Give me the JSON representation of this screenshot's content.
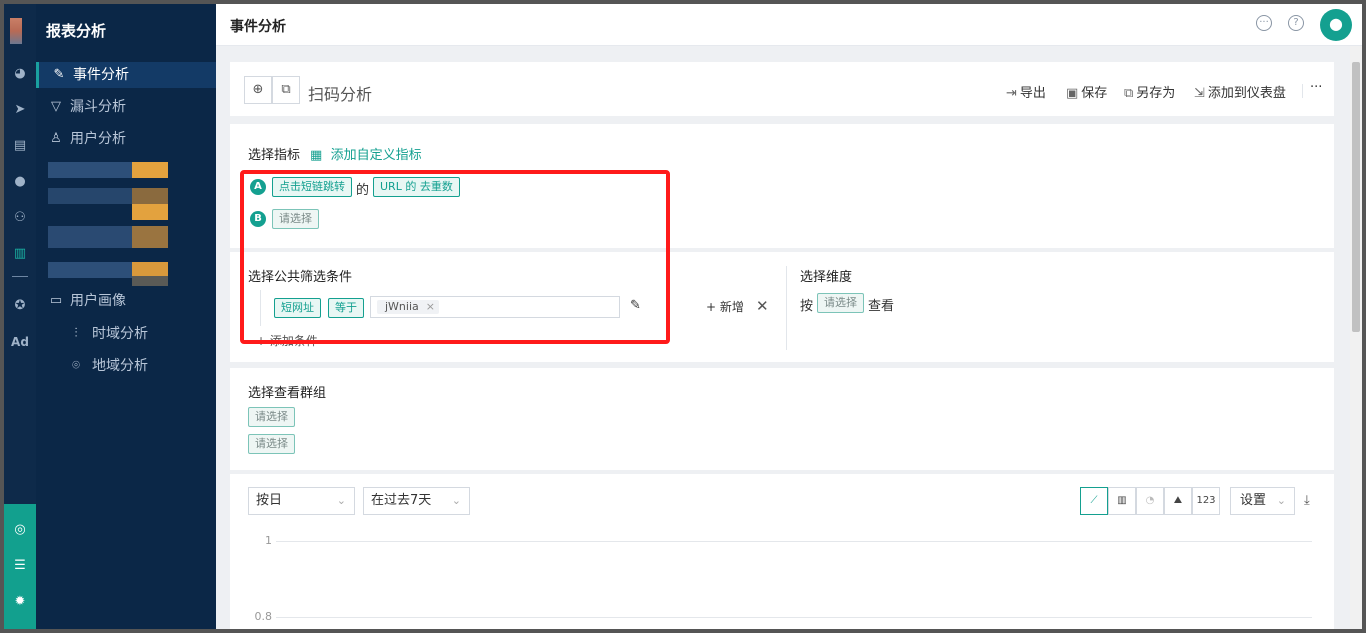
{
  "app": {
    "title": "报表分析"
  },
  "sidebar": {
    "items": [
      {
        "label": "事件分析",
        "icon": "edit-doc-icon"
      },
      {
        "label": "漏斗分析",
        "icon": "funnel-icon"
      },
      {
        "label": "用户分析",
        "icon": "user-icon"
      },
      {
        "label": "用户画像",
        "icon": "folder-icon"
      }
    ],
    "sub_items": [
      {
        "label": "时域分析",
        "icon": "bar-chart-icon"
      },
      {
        "label": "地域分析",
        "icon": "location-icon"
      }
    ]
  },
  "rail": {
    "ad_label": "Ad"
  },
  "topbar": {
    "title": "事件分析"
  },
  "header": {
    "analysis_name": "扫码分析",
    "export_label": "导出",
    "save_label": "保存",
    "save_as_label": "另存为",
    "add_dashboard_label": "添加到仪表盘",
    "more_label": "···"
  },
  "metrics": {
    "title": "选择指标",
    "add_custom_label": "添加自定义指标",
    "row_a": {
      "badge": "A",
      "event": "点击短链跳转",
      "connector": "的",
      "measure": "URL 的 去重数"
    },
    "row_b": {
      "badge": "B",
      "placeholder": "请选择"
    }
  },
  "filters": {
    "title": "选择公共筛选条件",
    "field": "短网址",
    "operator": "等于",
    "value_chip": "jWniia",
    "new_label": "新增",
    "add_condition_label": "添加条件"
  },
  "dimension": {
    "title": "选择维度",
    "prefix": "按",
    "placeholder": "请选择",
    "suffix": "查看"
  },
  "groups": {
    "title": "选择查看群组",
    "items": [
      "请选择",
      "请选择"
    ]
  },
  "chart_controls": {
    "granularity": "按日",
    "range": "在过去7天",
    "number_label": "123",
    "settings_label": "设置"
  },
  "chart": {
    "y_ticks": [
      "1",
      "0.8"
    ]
  },
  "colors": {
    "accent": "#14a090",
    "sidebar": "#0b2747",
    "highlight": "#ff1a1a"
  }
}
